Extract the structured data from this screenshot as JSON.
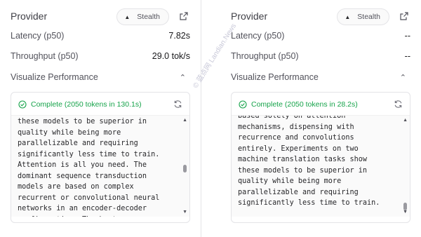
{
  "panels": [
    {
      "provider_label": "Provider",
      "stealth_label": "Stealth",
      "latency_label": "Latency (p50)",
      "latency_value": "7.82s",
      "throughput_label": "Throughput (p50)",
      "throughput_value": "29.0 tok/s",
      "visualize_label": "Visualize Performance",
      "status": "Complete (2050 tokens in 130.1s)",
      "output_text": "these models to be superior in\nquality while being more\nparallelizable and requiring\nsignificantly less time to train.\nAttention is all you need. The\ndominant sequence transduction\nmodels are based on complex\nrecurrent or convolutional neural\nnetworks in an encoder-decoder\nconfiguration. The best"
    },
    {
      "provider_label": "Provider",
      "stealth_label": "Stealth",
      "latency_label": "Latency (p50)",
      "latency_value": "--",
      "throughput_label": "Throughput (p50)",
      "throughput_value": "--",
      "visualize_label": "Visualize Performance",
      "status": "Complete (2050 tokens in 28.2s)",
      "output_text": "based solely on attention\nmechanisms, dispensing with\nrecurrence and convolutions\nentirely. Experiments on two\nmachine translation tasks show\nthese models to be superior in\nquality while being more\nparallelizable and requiring\nsignificantly less time to train."
    }
  ],
  "watermark": "© 蓝点网 Landian.News",
  "colors": {
    "success": "#16a34a",
    "border": "#e4e4e7",
    "muted": "#52525b"
  },
  "icons": {
    "stealth": "caret-up-icon",
    "external": "external-link-icon",
    "collapse": "chevron-up-icon",
    "status": "check-circle-icon",
    "refresh": "refresh-icon"
  }
}
